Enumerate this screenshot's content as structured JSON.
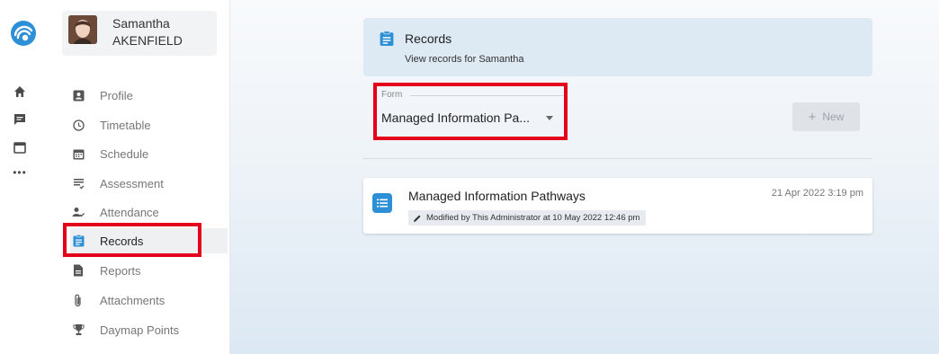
{
  "app": {
    "colors": {
      "accent": "#2d8fd5",
      "highlight": "#e4001b"
    },
    "rail_icons": [
      "app-logo",
      "home-icon",
      "messages-icon",
      "calendar-icon",
      "more-icon"
    ]
  },
  "student": {
    "first_name": "Samantha",
    "last_name": "AKENFIELD"
  },
  "sidebar": {
    "items": [
      {
        "label": "Profile",
        "icon": "profile-icon"
      },
      {
        "label": "Timetable",
        "icon": "clock-icon"
      },
      {
        "label": "Schedule",
        "icon": "calendar-grid-icon"
      },
      {
        "label": "Assessment",
        "icon": "assessment-icon"
      },
      {
        "label": "Attendance",
        "icon": "attendance-icon"
      },
      {
        "label": "Records",
        "icon": "clipboard-icon",
        "active": true
      },
      {
        "label": "Reports",
        "icon": "document-icon"
      },
      {
        "label": "Attachments",
        "icon": "paperclip-icon"
      },
      {
        "label": "Daymap Points",
        "icon": "trophy-icon"
      }
    ]
  },
  "header": {
    "title": "Records",
    "subtitle": "View records for Samantha"
  },
  "form": {
    "label": "Form",
    "selected": "Managed Information Pa..."
  },
  "new_button": {
    "label": "New",
    "icon": "plus-icon"
  },
  "records": [
    {
      "title": "Managed Information Pathways",
      "date": "21 Apr 2022 3:19 pm",
      "modified": "Modified by This Administrator at 10 May 2022 12:46 pm"
    }
  ]
}
